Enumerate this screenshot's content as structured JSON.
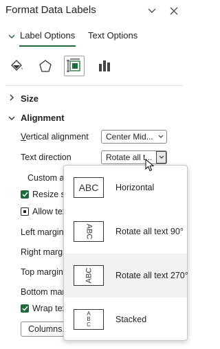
{
  "panel": {
    "title": "Format Data Labels"
  },
  "tabs": [
    {
      "label": "Label Options",
      "selected": true
    },
    {
      "label": "Text Options",
      "selected": false
    }
  ],
  "category_icons": [
    "paint-bucket-icon",
    "pentagon-effects-icon",
    "size-properties-icon",
    "label-options-chart-icon"
  ],
  "sections": {
    "size": "Size",
    "alignment": "Alignment"
  },
  "alignment": {
    "vertical_alignment_label": "Vertical alignment",
    "vertical_alignment_value": "Center Mid...",
    "text_direction_label": "Text direction",
    "text_direction_value": "Rotate all t...",
    "custom_angle_label": "Custom a",
    "resize_label": "Resize sh",
    "resize_checked": true,
    "allow_label": "Allow tex",
    "allow_checked": false,
    "left_margin_label": "Left margin",
    "right_margin_label": "Right margi",
    "top_margin_label": "Top margin",
    "bottom_margin_label": "Bottom mar",
    "wrap_label": "Wrap tex",
    "wrap_checked": true,
    "columns_button": "Columns..."
  },
  "text_direction_menu": [
    {
      "preview": "ABC",
      "label": "Horizontal"
    },
    {
      "preview": "ABC",
      "label": "Rotate all text 90°"
    },
    {
      "preview": "ABC",
      "label": "Rotate all text 270°",
      "highlighted": true
    },
    {
      "preview": "ABC",
      "label": "Stacked"
    }
  ],
  "colors": {
    "accent": "#1e6b3a",
    "hover": "#f2f2f2"
  }
}
